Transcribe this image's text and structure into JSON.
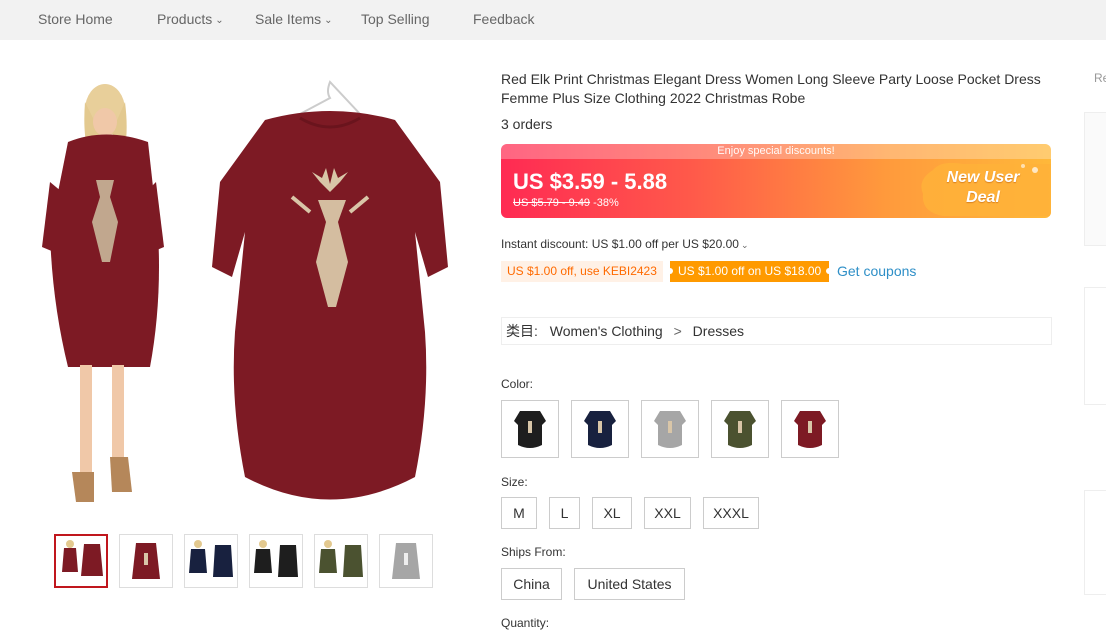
{
  "nav": {
    "items": [
      {
        "label": "Store Home",
        "dropdown": false
      },
      {
        "label": "Products",
        "dropdown": true
      },
      {
        "label": "Sale Items",
        "dropdown": true
      },
      {
        "label": "Top Selling",
        "dropdown": false
      },
      {
        "label": "Feedback",
        "dropdown": false
      }
    ]
  },
  "product": {
    "title": "Red Elk Print Christmas Elegant Dress Women Long Sleeve Party Loose Pocket Dress Femme Plus Size Clothing 2022 Christmas Robe",
    "orders": "3 orders",
    "thumbnail_count": 6,
    "selected_thumbnail": 0
  },
  "price": {
    "banner": "Enjoy special discounts!",
    "current": "US $3.59 - 5.88",
    "original": "US $5.79 - 9.49",
    "discount": "-38%",
    "deal_label_line1": "New User",
    "deal_label_line2": "Deal"
  },
  "discounts": {
    "instant": "Instant discount: US $1.00 off per US $20.00",
    "coupon_code": "US $1.00 off, use KEBI2423",
    "coupon_store": "US $1.00 off on US $18.00",
    "get_coupons": "Get coupons"
  },
  "category": {
    "label": "类目:",
    "path": [
      "Women's Clothing",
      "Dresses"
    ],
    "separator": ">"
  },
  "options": {
    "color_label": "Color:",
    "colors": [
      "#1e1e1e",
      "#18213f",
      "#a6a6a6",
      "#4b5230",
      "#7d1a24"
    ],
    "size_label": "Size:",
    "sizes": [
      "M",
      "L",
      "XL",
      "XXL",
      "XXXL"
    ],
    "ships_label": "Ships From:",
    "ships_from": [
      "China",
      "United States"
    ],
    "quantity_label": "Quantity:"
  },
  "right_column": {
    "label": "Re"
  },
  "colors": {
    "accent_red": "#c0161d",
    "dress_burgundy": "#7d1a24",
    "link_blue": "#2e8fc7",
    "coupon_orange": "#ff9a00"
  }
}
